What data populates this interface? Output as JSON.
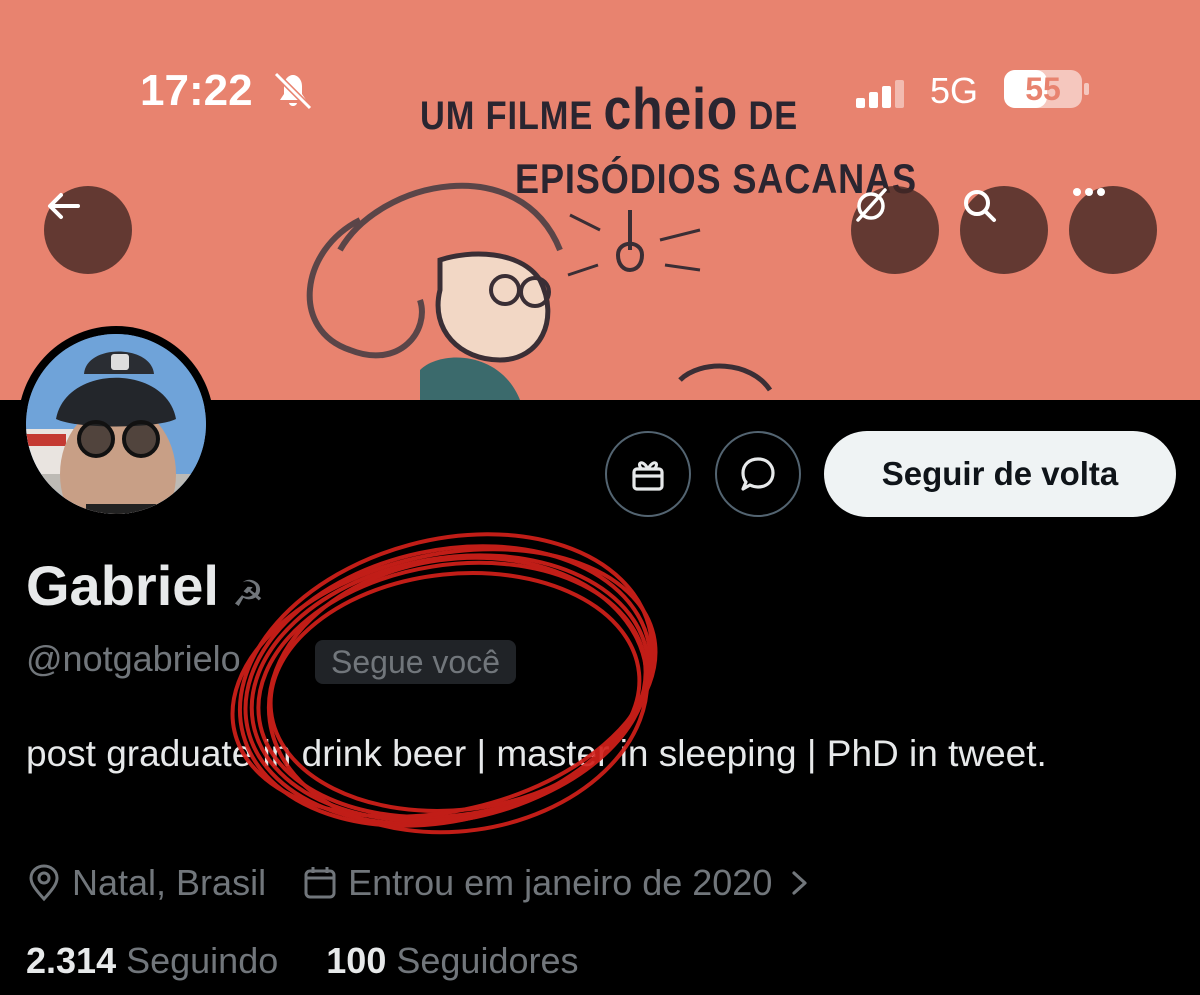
{
  "status_bar": {
    "time": "17:22",
    "network": "5G",
    "battery": "55",
    "battery_level": 0.55
  },
  "banner": {
    "line1_a": "UM FILME ",
    "line1_b": "cheio",
    "line1_c": " DE",
    "line2": "EPISÓDIOS SACANAS"
  },
  "header_buttons": {
    "back": "arrow-left-icon",
    "grok": "grok-icon",
    "search": "search-icon",
    "more": "more-icon"
  },
  "actions": {
    "follow_back": "Seguir de volta"
  },
  "profile": {
    "name": "Gabriel",
    "name_emoji": "☭",
    "handle": "@notgabrielo",
    "follows_you": "Segue você",
    "bio": "post graduate in drink beer | master in sleeping | PhD in tweet.",
    "location": "Natal, Brasil",
    "joined": "Entrou em janeiro de 2020",
    "following_count": "2.314",
    "following_label": "Seguindo",
    "followers_count": "100",
    "followers_label": "Seguidores"
  },
  "colors": {
    "banner": "#e8836f",
    "scribble": "#d2201a",
    "muted": "#71767b"
  }
}
